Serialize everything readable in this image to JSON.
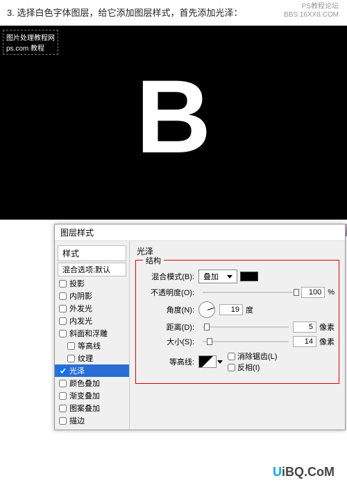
{
  "instruction": "3. 选择白色字体图层，给它添加图层样式，首先添加光泽：",
  "watermark_top_line1": "PS教程论坛",
  "watermark_top_line2": "BBS.16XX8.COM",
  "canvas": {
    "badge_line1": "图片处理教程网",
    "badge_line2": "ps.com 教程",
    "letter": "B"
  },
  "dialog": {
    "title": "图层样式",
    "sidebar": {
      "header": "样式",
      "sub": "混合选项:默认",
      "items": [
        {
          "label": "投影",
          "checked": false,
          "selected": false
        },
        {
          "label": "内阴影",
          "checked": false,
          "selected": false
        },
        {
          "label": "外发光",
          "checked": false,
          "selected": false
        },
        {
          "label": "内发光",
          "checked": false,
          "selected": false
        },
        {
          "label": "斜面和浮雕",
          "checked": false,
          "selected": false
        },
        {
          "label": "等高线",
          "checked": false,
          "selected": false,
          "indent": true
        },
        {
          "label": "纹理",
          "checked": false,
          "selected": false,
          "indent": true
        },
        {
          "label": "光泽",
          "checked": true,
          "selected": true
        },
        {
          "label": "颜色叠加",
          "checked": false,
          "selected": false
        },
        {
          "label": "渐变叠加",
          "checked": false,
          "selected": false
        },
        {
          "label": "图案叠加",
          "checked": false,
          "selected": false
        },
        {
          "label": "描边",
          "checked": false,
          "selected": false
        }
      ]
    },
    "panel": {
      "title": "光泽",
      "group_label": "结构",
      "blend_mode_label": "混合模式(B):",
      "blend_mode_value": "叠加",
      "opacity_label": "不透明度(O):",
      "opacity_value": "100",
      "opacity_unit": "%",
      "angle_label": "角度(N):",
      "angle_value": "19",
      "angle_unit": "度",
      "distance_label": "距离(D):",
      "distance_value": "5",
      "distance_unit": "像素",
      "size_label": "大小(S):",
      "size_value": "14",
      "size_unit": "像素",
      "contour_label": "等高线:",
      "antialias_label": "消除锯齿(L)",
      "invert_label": "反相(I)"
    }
  },
  "footer": {
    "u": "U",
    "rest": "iBQ.CoM"
  }
}
